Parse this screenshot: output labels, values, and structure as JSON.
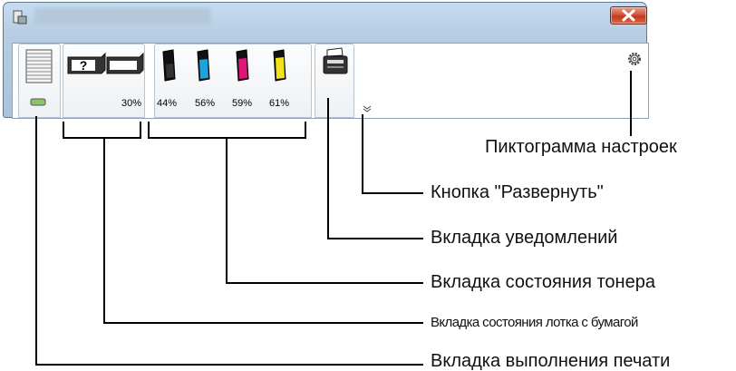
{
  "window": {
    "tabs": {
      "tray_percent": "30%",
      "toner_percents": [
        "44%",
        "56%",
        "59%",
        "61%"
      ]
    },
    "icons": {
      "app": "app-icon",
      "close": "close-icon",
      "print_job": "print-job-stack-icon",
      "tray_unknown": "paper-tray-unknown-icon",
      "tray": "paper-tray-icon",
      "toner": [
        "toner-black-icon",
        "toner-cyan-icon",
        "toner-magenta-icon",
        "toner-yellow-icon"
      ],
      "printer": "printer-icon",
      "expand": "chevron-down-icon",
      "settings": "gear-icon"
    }
  },
  "callouts": {
    "settings_icon": "Пиктограмма настроек",
    "expand_button": "Кнопка \"Развернуть\"",
    "notification_tab": "Вкладка уведомлений",
    "toner_status_tab": "Вкладка состояния тонера",
    "paper_tray_status_tab": "Вкладка состояния лотка с бумагой",
    "print_progress_tab": "Вкладка выполнения печати"
  },
  "colors": {
    "toner_black": "#1a1a1a",
    "toner_cyan": "#1ea3dc",
    "toner_magenta": "#e0157c",
    "toner_yellow": "#f2e21b",
    "close_button": "#c9432a"
  }
}
